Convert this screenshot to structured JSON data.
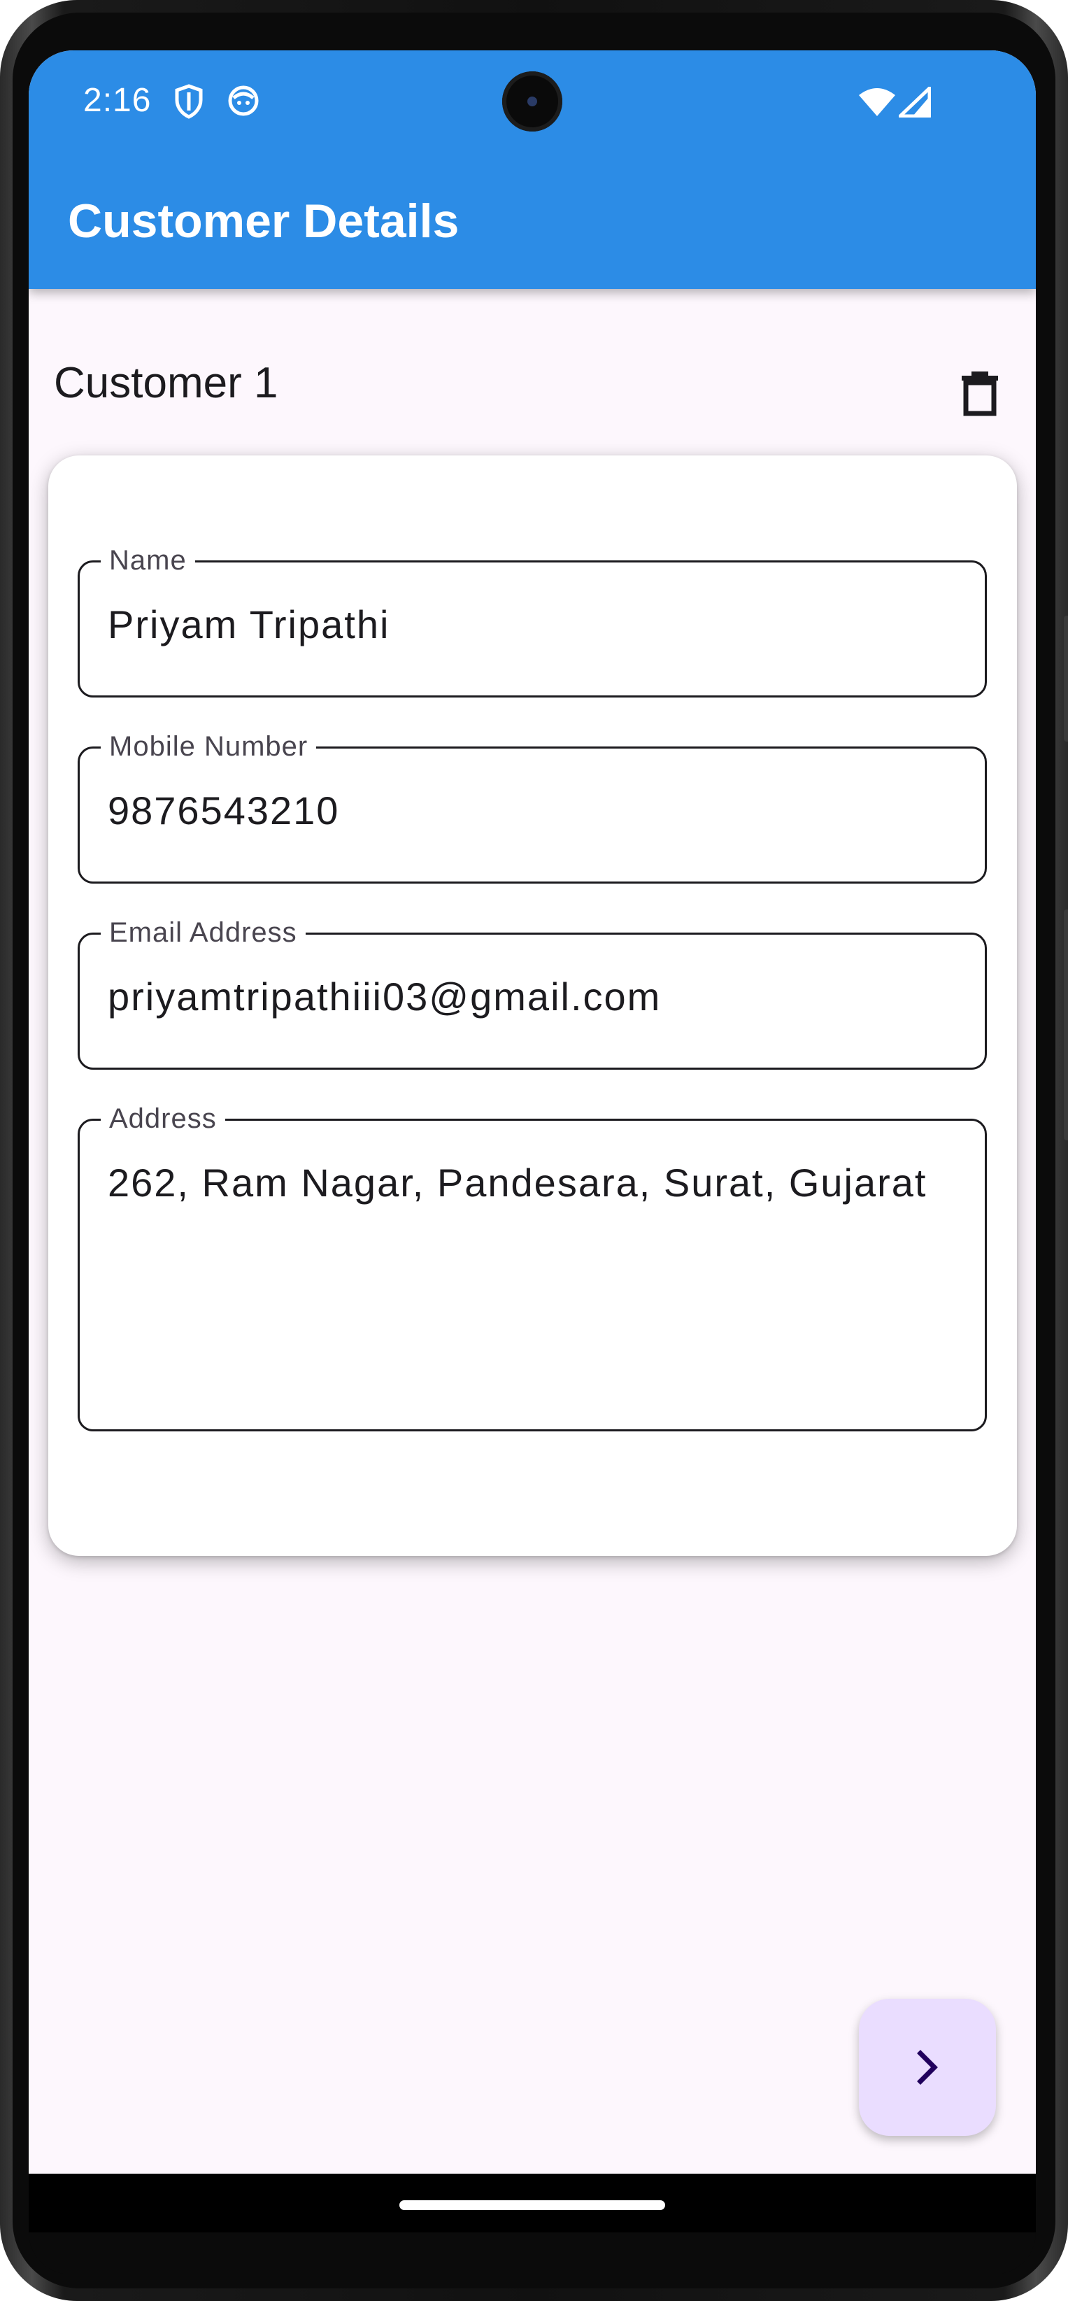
{
  "status_bar": {
    "time": "2:16",
    "icons": [
      "shield-icon",
      "face-icon",
      "wifi-icon",
      "signal-icon"
    ]
  },
  "app_bar": {
    "title": "Customer Details",
    "color": "#2c8ce6"
  },
  "section": {
    "title": "Customer 1",
    "delete_icon": "trash-icon"
  },
  "form": {
    "name": {
      "label": "Name",
      "value": "Priyam Tripathi"
    },
    "mobile": {
      "label": "Mobile Number",
      "value": "9876543210"
    },
    "email": {
      "label": "Email Address",
      "value": "priyamtripathiii03@gmail.com"
    },
    "address": {
      "label": "Address",
      "value": "262, Ram Nagar, Pandesara, Surat, Gujarat"
    }
  },
  "fab": {
    "icon": "chevron-right-icon",
    "color": "#eaddff"
  }
}
